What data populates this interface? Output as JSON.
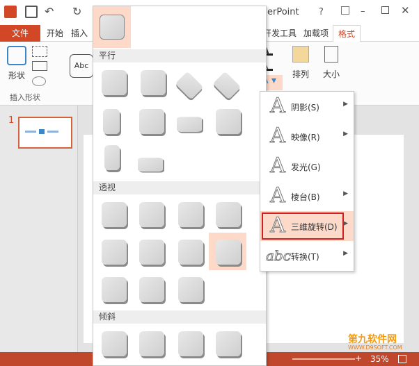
{
  "window": {
    "title_fragment": "erPoint"
  },
  "tabs": {
    "file": "文件",
    "home": "开始",
    "insert": "插入",
    "contextual_group": "开发工具",
    "addins": "加载项",
    "format": "格式"
  },
  "ribbon": {
    "shape_button": "形状",
    "insert_shapes_group": "插入形状",
    "style_preview": "Abc",
    "arrange_label": "排列",
    "size_label": "大小"
  },
  "slides": {
    "slide_number": "1"
  },
  "gallery": {
    "sections": [
      "平行",
      "透视",
      "倾斜"
    ]
  },
  "text_effects_menu": {
    "items": [
      {
        "label": "阴影(S)",
        "has_submenu": true
      },
      {
        "label": "映像(R)",
        "has_submenu": true
      },
      {
        "label": "发光(G)",
        "has_submenu": true
      },
      {
        "label": "棱台(B)",
        "has_submenu": true
      },
      {
        "label": "三维旋转(D)",
        "has_submenu": true,
        "highlighted": true
      },
      {
        "label": "转换(T)",
        "has_submenu": true
      }
    ]
  },
  "status": {
    "zoom": "35%"
  },
  "watermark": {
    "site_cn": "第九软件网",
    "site_en": "WWW.D9SOFT.COM"
  },
  "colors": {
    "accent": "#d24726",
    "highlight": "#fcd9c8",
    "red_box": "#d01f1f"
  }
}
